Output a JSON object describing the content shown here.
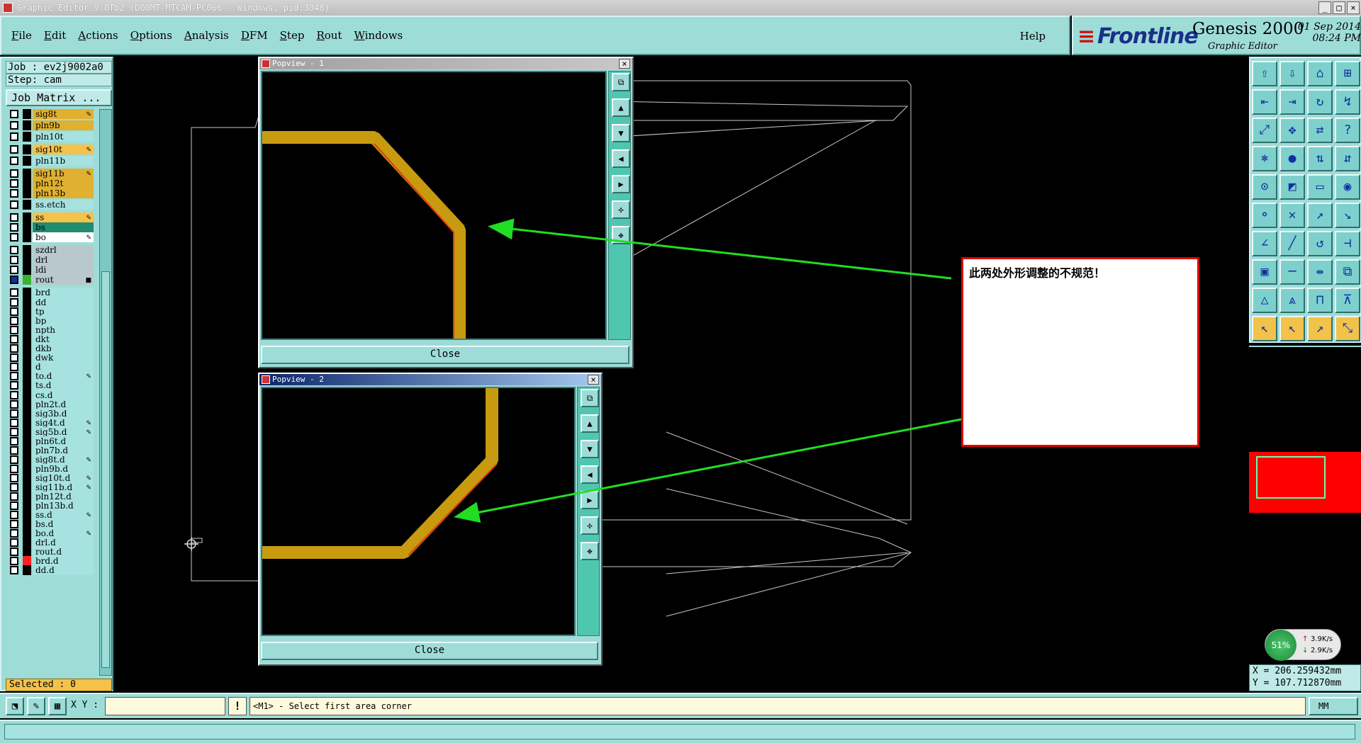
{
  "window": {
    "title": "Graphic Editor 9.0Tb2 (DO0MT-MTCAM-PC066 - Windows, pid:3048)"
  },
  "menu": {
    "items": [
      {
        "key": "F",
        "rest": "ile"
      },
      {
        "key": "E",
        "rest": "dit"
      },
      {
        "key": "A",
        "rest": "ctions"
      },
      {
        "key": "O",
        "rest": "ptions"
      },
      {
        "key": "A",
        "rest": "nalysis"
      },
      {
        "key": "D",
        "rest": "FM"
      },
      {
        "key": "S",
        "rest": "tep"
      },
      {
        "key": "R",
        "rest": "out"
      },
      {
        "key": "W",
        "rest": "indows"
      }
    ],
    "help": "Help"
  },
  "brand": {
    "logo": "Frontline",
    "product": "Genesis 2000",
    "subtitle": "Graphic Editor",
    "date": "01 Sep 2014",
    "time": "08:24 PM"
  },
  "job": {
    "job_label": "Job : ev2j9002a0",
    "step_label": "Step: cam",
    "matrix_button": "Job Matrix ..."
  },
  "layers": [
    {
      "name": "sig8t",
      "color": "#e0b030",
      "flag": "✎"
    },
    {
      "name": "pln9b",
      "color": "#e0b030",
      "flag": ""
    },
    {
      "name": "pln10t",
      "color": "",
      "flag": ""
    },
    {
      "name": "sig10t",
      "color": "#f5c24a",
      "flag": "✎"
    },
    {
      "name": "pln11b",
      "color": "",
      "flag": ""
    },
    {
      "name": "sig11b",
      "color": "#e0b030",
      "flag": "✎"
    },
    {
      "name": "pln12t",
      "color": "#e0b030",
      "flag": ""
    },
    {
      "name": "pln13b",
      "color": "#e0b030",
      "flag": ""
    },
    {
      "name": "ss.etch",
      "color": "",
      "flag": ""
    },
    {
      "name": "ss",
      "color": "#f5c24a",
      "flag": "✎"
    },
    {
      "name": "bs",
      "color": "#208c70",
      "flag": ""
    },
    {
      "name": "bo",
      "color": "#ffffff",
      "flag": "✎"
    },
    {
      "name": "szdrl",
      "color": "#b8c8cc",
      "flag": ""
    },
    {
      "name": "drl",
      "color": "#b8c8cc",
      "flag": ""
    },
    {
      "name": "ldi",
      "color": "#b8c8cc",
      "flag": ""
    },
    {
      "name": "rout",
      "color": "#b8c8cc",
      "flag": "■"
    },
    {
      "name": "brd",
      "color": "",
      "flag": ""
    },
    {
      "name": "dd",
      "color": "",
      "flag": ""
    },
    {
      "name": "tp",
      "color": "",
      "flag": ""
    },
    {
      "name": "bp",
      "color": "",
      "flag": ""
    },
    {
      "name": "npth",
      "color": "",
      "flag": ""
    },
    {
      "name": "dkt",
      "color": "",
      "flag": ""
    },
    {
      "name": "dkb",
      "color": "",
      "flag": ""
    },
    {
      "name": "dwk",
      "color": "",
      "flag": ""
    },
    {
      "name": "d",
      "color": "",
      "flag": ""
    },
    {
      "name": "to.d",
      "color": "",
      "flag": "✎"
    },
    {
      "name": "ts.d",
      "color": "",
      "flag": ""
    },
    {
      "name": "cs.d",
      "color": "",
      "flag": ""
    },
    {
      "name": "pln2t.d",
      "color": "",
      "flag": ""
    },
    {
      "name": "sig3b.d",
      "color": "",
      "flag": ""
    },
    {
      "name": "sig4t.d",
      "color": "",
      "flag": "✎"
    },
    {
      "name": "sig5b.d",
      "color": "",
      "flag": "✎"
    },
    {
      "name": "pln6t.d",
      "color": "",
      "flag": ""
    },
    {
      "name": "pln7b.d",
      "color": "",
      "flag": ""
    },
    {
      "name": "sig8t.d",
      "color": "",
      "flag": "✎"
    },
    {
      "name": "pln9b.d",
      "color": "",
      "flag": ""
    },
    {
      "name": "sig10t.d",
      "color": "",
      "flag": "✎"
    },
    {
      "name": "sig11b.d",
      "color": "",
      "flag": "✎"
    },
    {
      "name": "pln12t.d",
      "color": "",
      "flag": ""
    },
    {
      "name": "pln13b.d",
      "color": "",
      "flag": ""
    },
    {
      "name": "ss.d",
      "color": "",
      "flag": "✎"
    },
    {
      "name": "bs.d",
      "color": "",
      "flag": ""
    },
    {
      "name": "bo.d",
      "color": "",
      "flag": "✎"
    },
    {
      "name": "drl.d",
      "color": "",
      "flag": ""
    },
    {
      "name": "rout.d",
      "color": "",
      "flag": ""
    },
    {
      "name": "brd.d",
      "color": "",
      "flag": ""
    },
    {
      "name": "dd.d",
      "color": "",
      "flag": ""
    }
  ],
  "selected_label": "Selected : 0",
  "popview1": {
    "title": "Popview - 1",
    "close_label": "Close"
  },
  "popview2": {
    "title": "Popview - 2",
    "close_label": "Close"
  },
  "callout": {
    "text": "此两处外形调整的不规范！"
  },
  "network": {
    "percent": "51%",
    "up": "3.9K/s",
    "down": "2.9K/s"
  },
  "coords": {
    "x": "X = 206.259432mm",
    "y": "Y = 107.712870mm"
  },
  "cmd": {
    "xy_label": "X Y :",
    "xy_value": "",
    "warn": "!",
    "prompt": "<M1> - Select first area corner",
    "units": "MM"
  },
  "colors": {
    "teal": "#9edcd8",
    "copper": "#c89a10",
    "annotation_arrow": "#22dd22",
    "alert": "#e00000"
  }
}
